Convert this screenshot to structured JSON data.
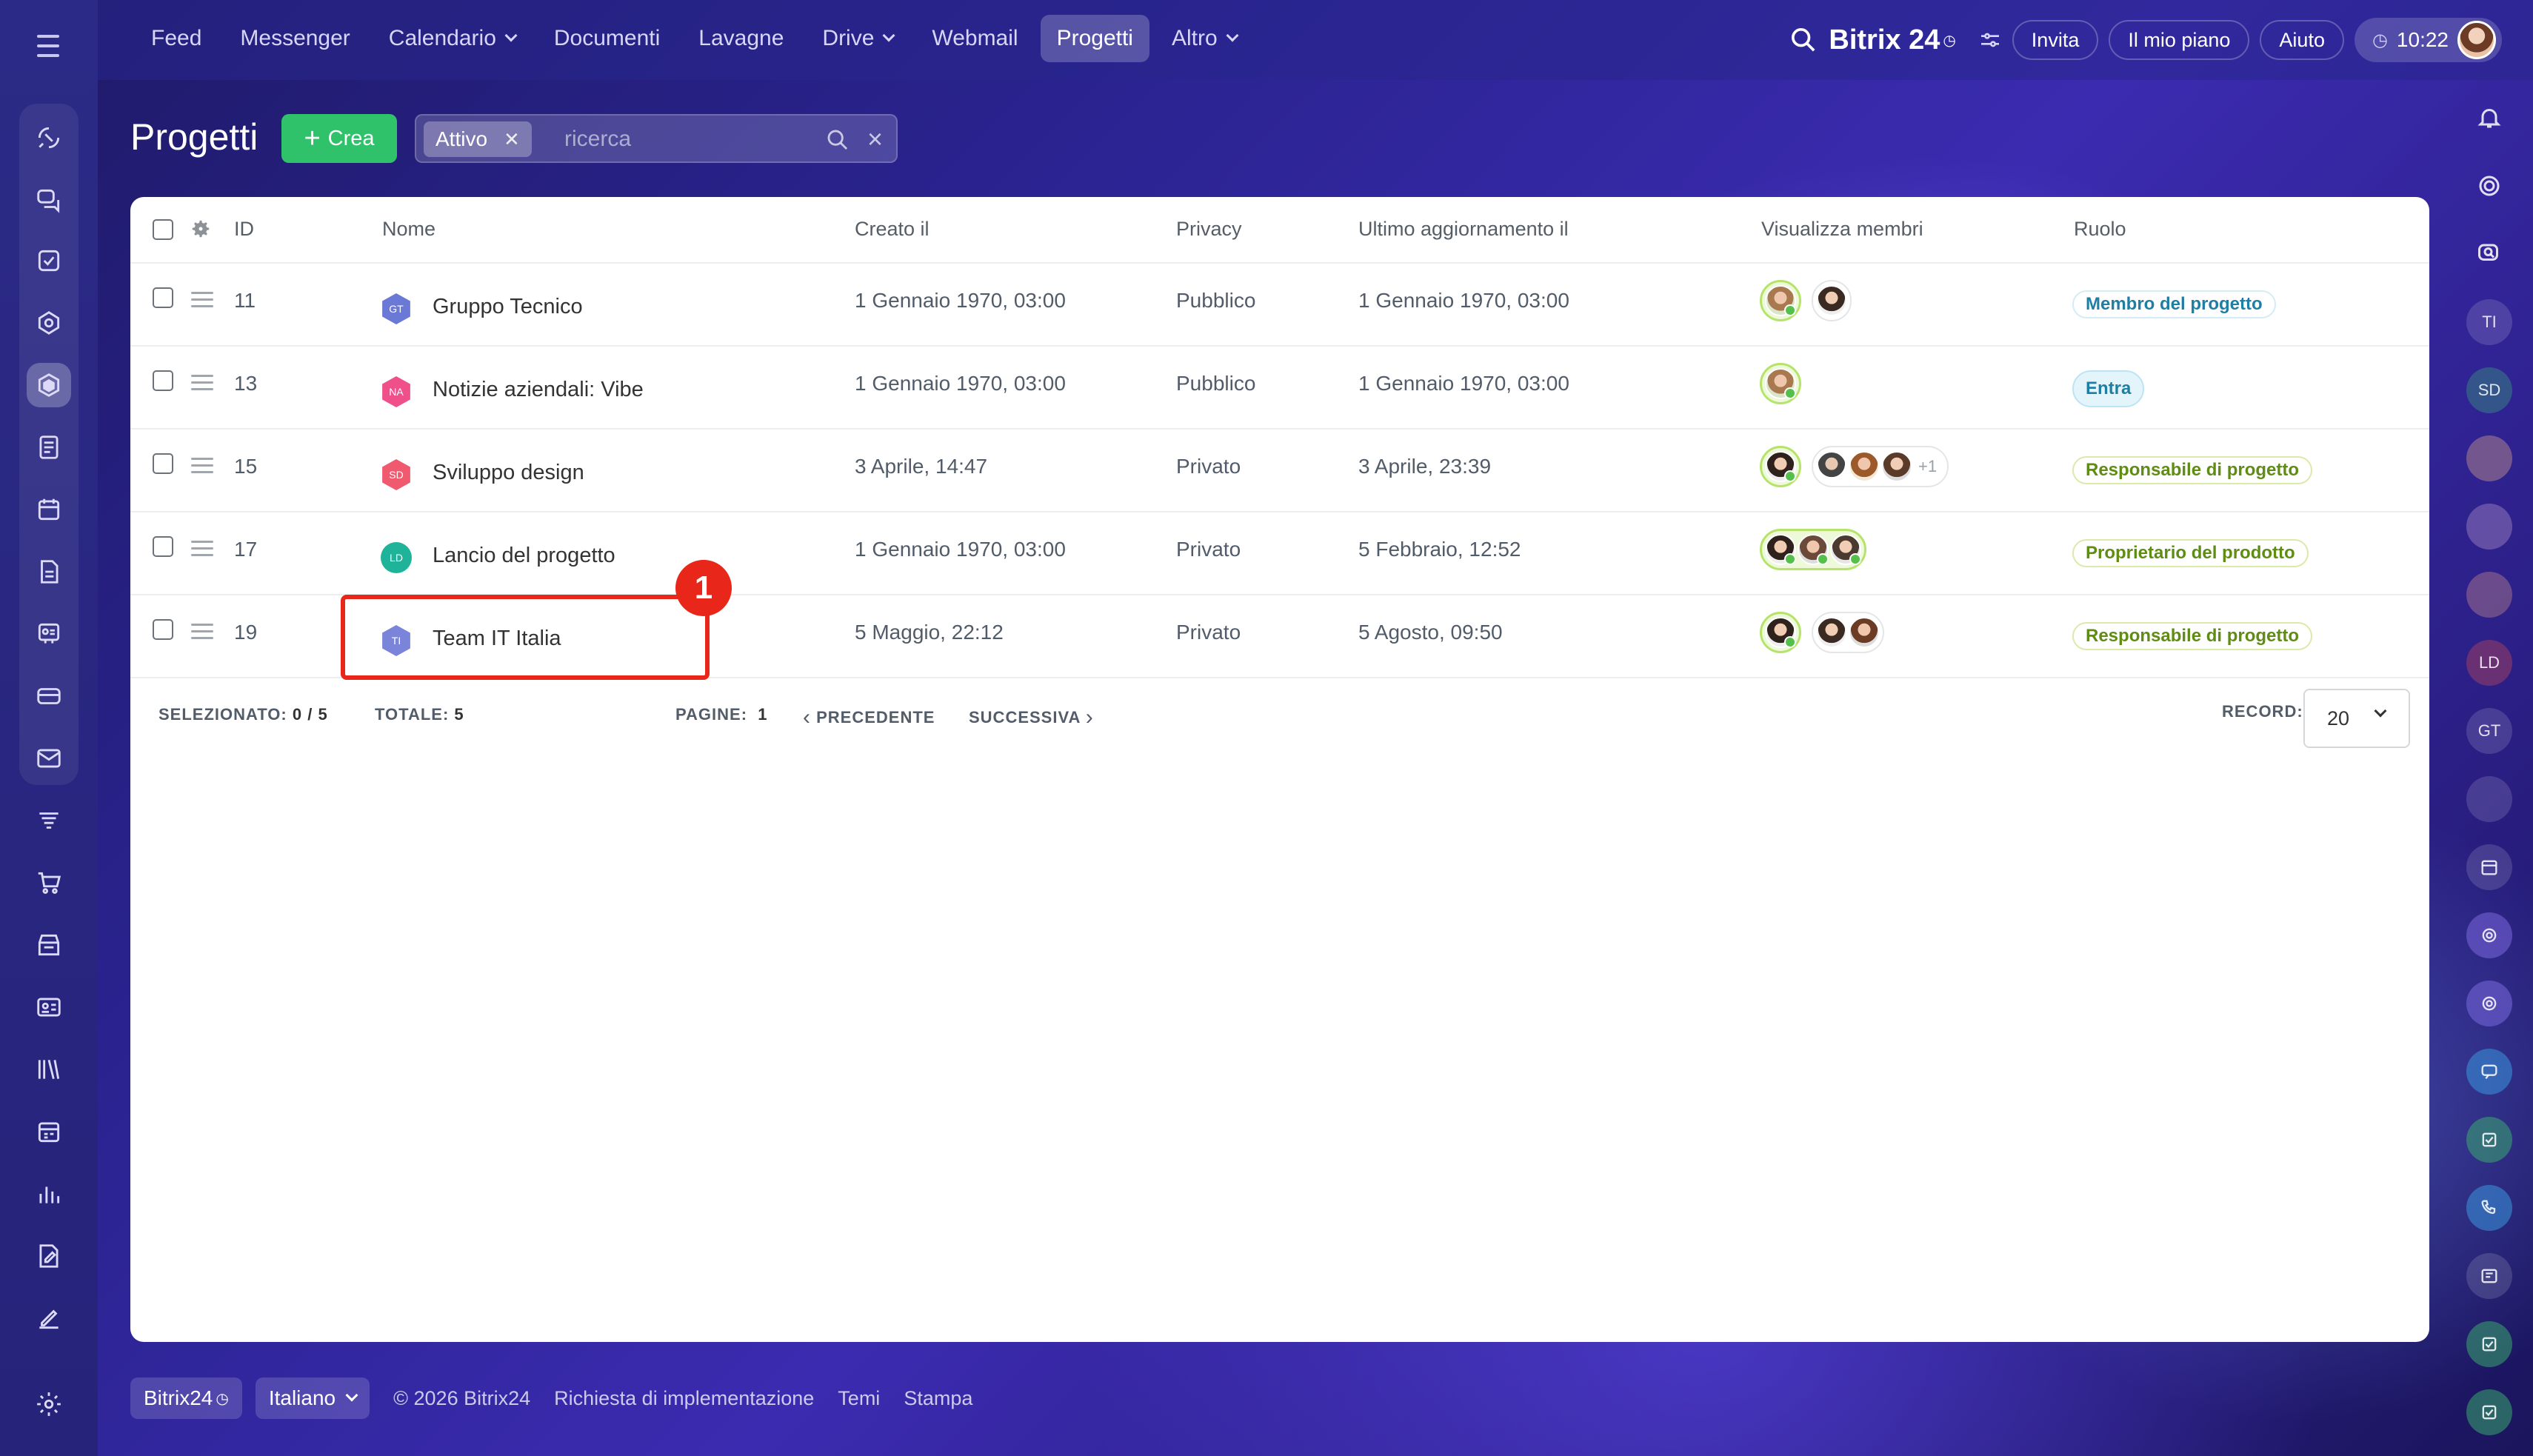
{
  "nav": {
    "items": [
      {
        "label": "Feed"
      },
      {
        "label": "Messenger"
      },
      {
        "label": "Calendario"
      },
      {
        "label": "Documenti"
      },
      {
        "label": "Lavagne"
      },
      {
        "label": "Drive"
      },
      {
        "label": "Webmail"
      },
      {
        "label": "Progetti"
      },
      {
        "label": "Altro"
      }
    ],
    "active": "Progetti"
  },
  "topright": {
    "brand": "Bitrix 24",
    "invite": "Invita",
    "plan": "Il mio piano",
    "help": "Aiuto",
    "time": "10:22"
  },
  "header": {
    "title": "Progetti",
    "create_label": "Crea",
    "filter_tag": "Attivo",
    "search_placeholder": "ricerca"
  },
  "table": {
    "columns": {
      "id": "ID",
      "name": "Nome",
      "created": "Creato il",
      "privacy": "Privacy",
      "updated": "Ultimo aggiornamento il",
      "members": "Visualizza membri",
      "role": "Ruolo"
    },
    "rows": [
      {
        "id": "11",
        "initials": "GT",
        "name": "Gruppo Tecnico",
        "created": "1 Gennaio 1970, 03:00",
        "privacy": "Pubblico",
        "updated": "1 Gennaio 1970, 03:00",
        "role": "Membro del progetto",
        "extra": ""
      },
      {
        "id": "13",
        "initials": "NA",
        "name": "Notizie aziendali: Vibe",
        "created": "1 Gennaio 1970, 03:00",
        "privacy": "Pubblico",
        "updated": "1 Gennaio 1970, 03:00",
        "role": "Entra",
        "extra": ""
      },
      {
        "id": "15",
        "initials": "SD",
        "name": "Sviluppo design",
        "created": "3 Aprile, 14:47",
        "privacy": "Privato",
        "updated": "3 Aprile, 23:39",
        "role": "Responsabile di progetto",
        "extra": "+1"
      },
      {
        "id": "17",
        "initials": "LD",
        "name": "Lancio del progetto",
        "created": "1 Gennaio 1970, 03:00",
        "privacy": "Privato",
        "updated": "5 Febbraio, 12:52",
        "role": "Proprietario del prodotto",
        "extra": ""
      },
      {
        "id": "19",
        "initials": "TI",
        "name": "Team IT Italia",
        "created": "5 Maggio, 22:12",
        "privacy": "Privato",
        "updated": "5 Agosto, 09:50",
        "role": "Responsabile di progetto",
        "extra": ""
      }
    ]
  },
  "pager": {
    "selected_label": "SELEZIONATO:",
    "selected_value": "0 / 5",
    "total_label": "TOTALE:",
    "total_value": "5",
    "pages_label": "PAGINE:",
    "pages_value": "1",
    "prev": "PRECEDENTE",
    "next": "SUCCESSIVA",
    "record_label": "RECORD:",
    "record_value": "20"
  },
  "annotation": {
    "number": "1"
  },
  "right_rail": {
    "ti": "TI",
    "sd": "SD",
    "ld": "LD",
    "gt": "GT"
  },
  "footer": {
    "brand": "Bitrix24",
    "language": "Italiano",
    "copyright": "© 2026 Bitrix24",
    "implementation": "Richiesta di implementazione",
    "themes": "Temi",
    "print": "Stampa"
  },
  "colors": {
    "accent_green": "#2fc26b",
    "annotation_red": "#e8261a",
    "role_blue": "#1f7ea4",
    "role_green": "#5f8c12"
  }
}
